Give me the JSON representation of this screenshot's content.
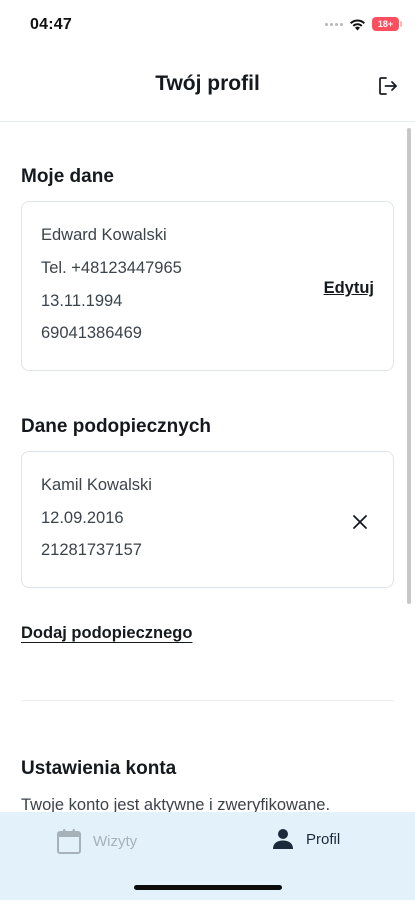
{
  "status_bar": {
    "time": "04:47",
    "battery_label": "18+"
  },
  "header": {
    "title": "Twój profil"
  },
  "my_data": {
    "title": "Moje dane",
    "name": "Edward Kowalski",
    "phone": "Tel.  +48123447965",
    "birth_date": "13.11.1994",
    "pesel": "69041386469",
    "edit_label": "Edytuj"
  },
  "dependents": {
    "title": "Dane podopiecznych",
    "items": [
      {
        "name": "Kamil Kowalski",
        "birth_date": "12.09.2016",
        "pesel": "21281737157"
      }
    ],
    "add_label": "Dodaj podopiecznego"
  },
  "account_settings": {
    "title": "Ustawienia konta",
    "status_text": "Twoje konto jest aktywne i zweryfikowane."
  },
  "bottom_nav": {
    "visits_label": "Wizyty",
    "profile_label": "Profil"
  },
  "colors": {
    "nav_background": "#e3f1fb",
    "active_nav": "#1b2a3a",
    "inactive_nav": "#a6b1ba"
  },
  "icons": {
    "logout": "logout-icon",
    "remove_dependent": "close-icon",
    "visits": "calendar-icon",
    "profile": "user-icon"
  }
}
